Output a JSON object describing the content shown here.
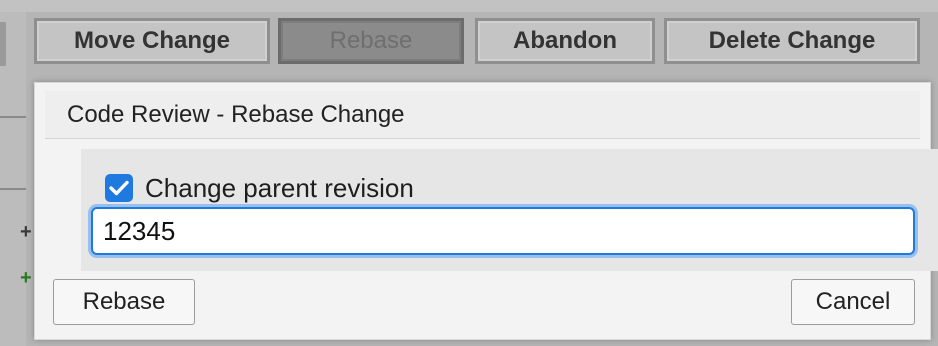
{
  "toolbar": {
    "buttons": [
      {
        "label": "Move Change",
        "active": false
      },
      {
        "label": "Rebase",
        "active": true
      },
      {
        "label": "Abandon",
        "active": false
      },
      {
        "label": "Delete Change",
        "active": false
      }
    ]
  },
  "background": {
    "diff_markers": [
      "+",
      "+"
    ]
  },
  "dialog": {
    "title": "Code Review - Rebase Change",
    "checkbox": {
      "label": "Change parent revision",
      "checked": true
    },
    "parent_input": {
      "value": "12345"
    },
    "rebase_button": "Rebase",
    "cancel_button": "Cancel"
  },
  "colors": {
    "accent": "#1f7ae0",
    "overlay": "#b5b5b5",
    "diff_added": "#2a7a22"
  },
  "icons": {
    "checkbox_check": "checkmark-icon"
  }
}
